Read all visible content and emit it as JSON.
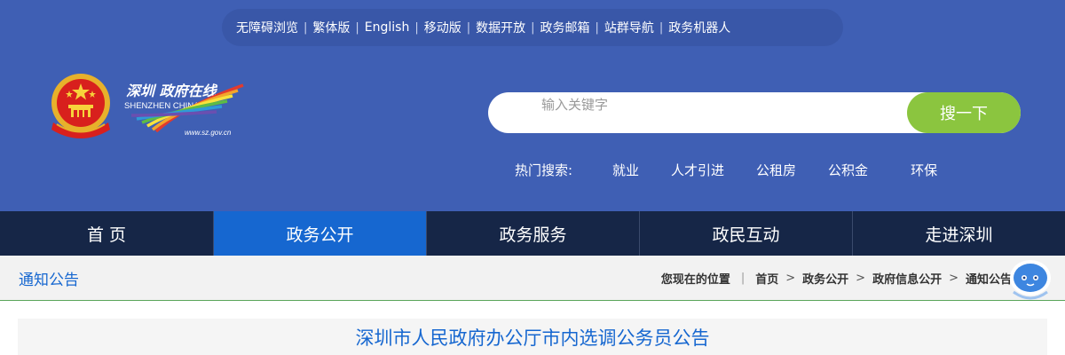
{
  "top_links": [
    "无障碍浏览",
    "繁体版",
    "English",
    "移动版",
    "数据开放",
    "政务邮箱",
    "站群导航",
    "政务机器人"
  ],
  "logo": {
    "brand_script": "深圳 政府在线",
    "brand_en": "SHENZHEN CHINA",
    "url_text": "www.sz.gov.cn"
  },
  "search": {
    "placeholder": "输入关键字",
    "button_label": "搜一下"
  },
  "hot": {
    "label": "热门搜索:",
    "items": [
      "就业",
      "人才引进",
      "公租房",
      "公积金",
      "环保"
    ]
  },
  "nav": {
    "items": [
      "首 页",
      "政务公开",
      "政务服务",
      "政民互动",
      "走进深圳"
    ],
    "active_index": 1
  },
  "section_title": "通知公告",
  "breadcrumb": {
    "prefix": "您现在的位置",
    "items": [
      "首页",
      "政务公开",
      "政府信息公开",
      "通知公告"
    ]
  },
  "article": {
    "title": "深圳市人民政府办公厅市内选调公务员公告"
  },
  "colors": {
    "header_bg": "#3f5fb4",
    "nav_bg": "#162647",
    "nav_active": "#1667d0",
    "search_button": "#8bc53f",
    "accent_text": "#1667d0"
  }
}
